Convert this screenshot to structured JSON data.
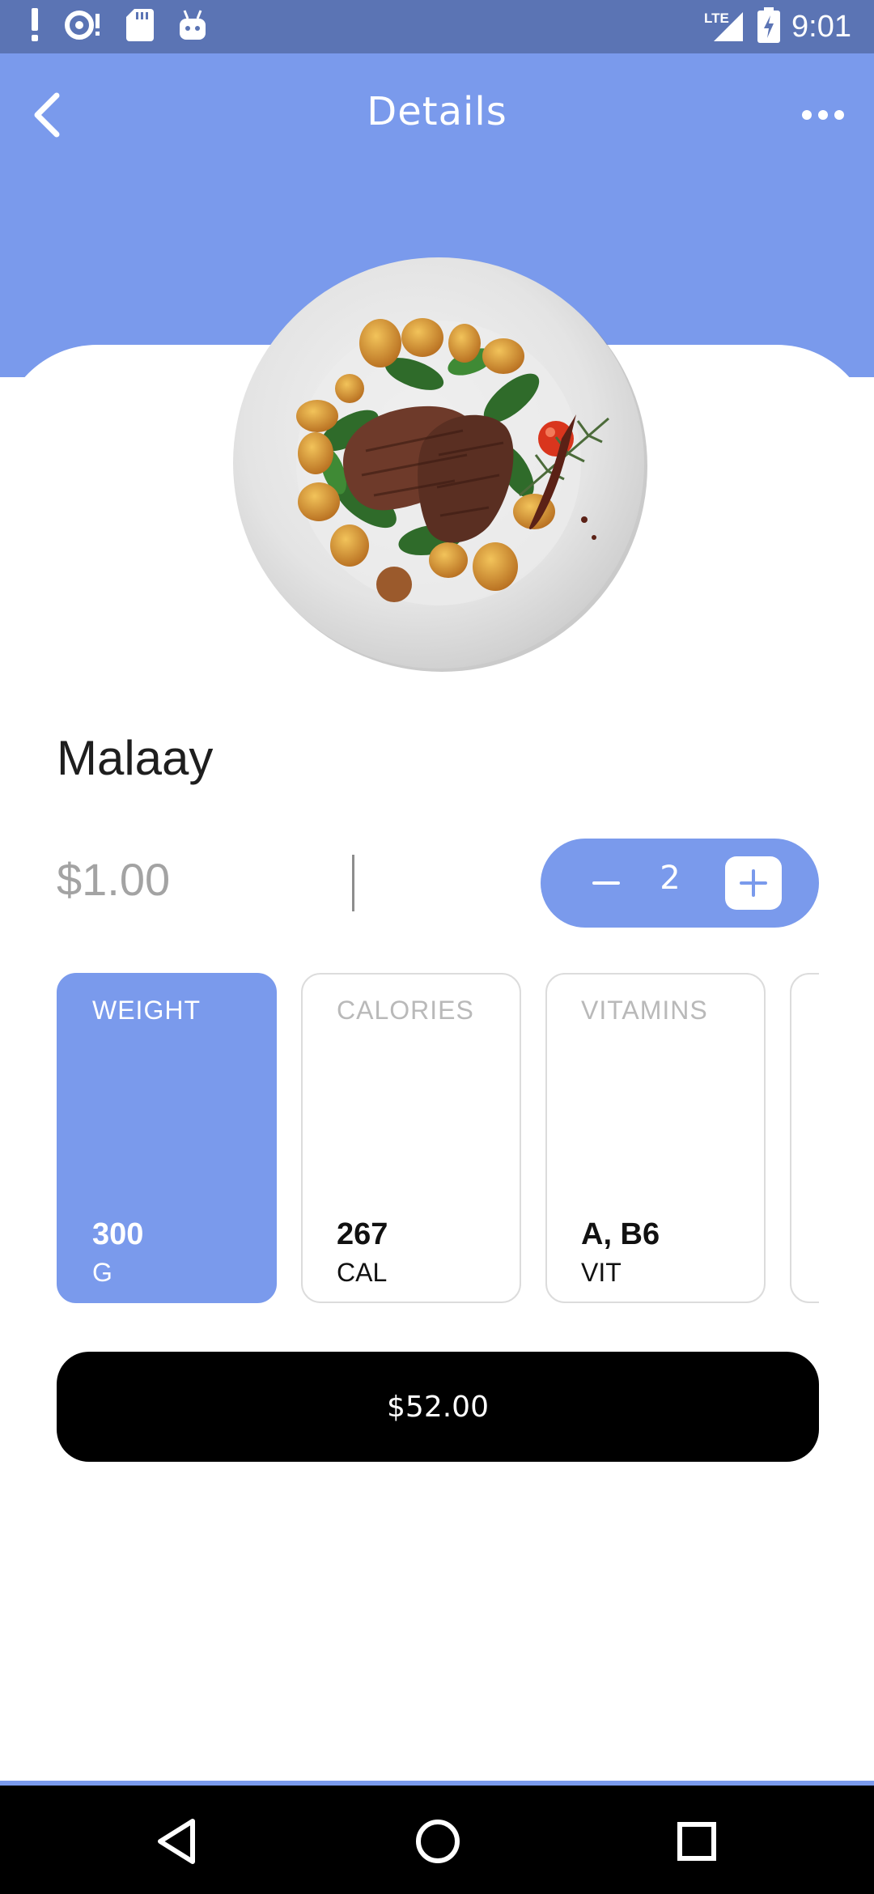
{
  "status_bar": {
    "time": "9:01",
    "network": "LTE",
    "left_icons": [
      "alert-icon",
      "sync-alert-icon",
      "sd-card-icon",
      "android-icon"
    ],
    "right_icons": [
      "signal-icon",
      "battery-charging-icon"
    ]
  },
  "header": {
    "title": "Details",
    "back_icon": "chevron-left-icon",
    "more_icon": "more-horizontal-icon",
    "color": "#7a9aec"
  },
  "product": {
    "name": "Malaay",
    "unit_price": "$1.00",
    "quantity": "2",
    "image": "steak-plate-image"
  },
  "tiles": [
    {
      "label": "WEIGHT",
      "value": "300",
      "unit": "G",
      "active": true
    },
    {
      "label": "CALORIES",
      "value": "267",
      "unit": "CAL",
      "active": false
    },
    {
      "label": "VITAMINS",
      "value": "A, B6",
      "unit": "VIT",
      "active": false
    }
  ],
  "total_button": {
    "label": "$52.00"
  },
  "nav": {
    "icons": [
      "back-triangle-icon",
      "home-circle-icon",
      "recents-square-icon"
    ]
  },
  "colors": {
    "accent": "#7a9aec",
    "status_bar": "#5b74b4",
    "button": "#000000"
  }
}
